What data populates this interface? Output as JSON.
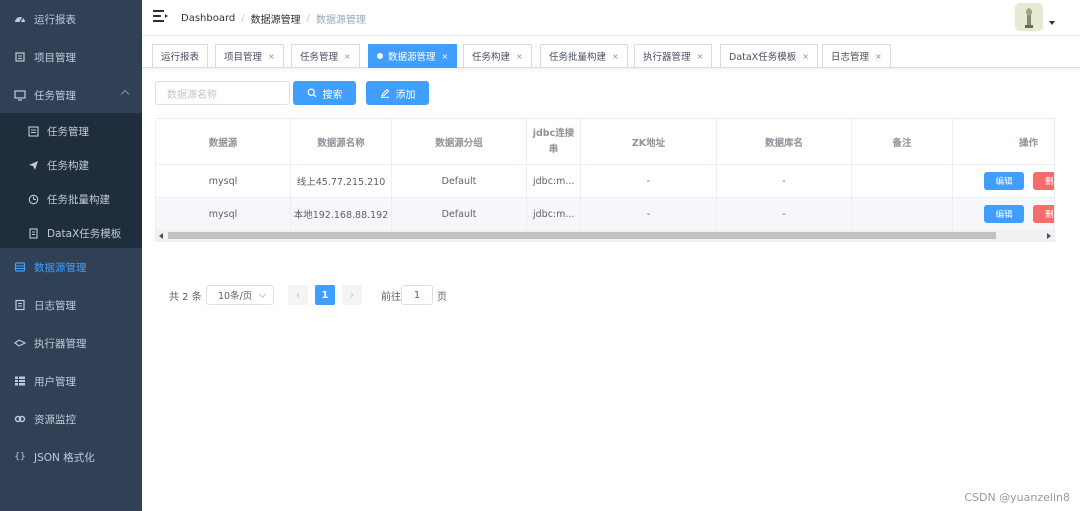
{
  "sidebar": {
    "items": [
      {
        "label": "运行报表",
        "icon": "dashboard-icon"
      },
      {
        "label": "项目管理",
        "icon": "project-icon"
      },
      {
        "label": "任务管理",
        "icon": "monitor-icon"
      },
      {
        "label": "数据源管理",
        "icon": "database-icon"
      },
      {
        "label": "日志管理",
        "icon": "log-icon"
      },
      {
        "label": "执行器管理",
        "icon": "executor-icon"
      },
      {
        "label": "用户管理",
        "icon": "user-table-icon"
      },
      {
        "label": "资源监控",
        "icon": "link-icon"
      },
      {
        "label": "JSON 格式化",
        "icon": "braces-icon"
      }
    ],
    "submenu": [
      {
        "label": "任务管理",
        "icon": "list-icon"
      },
      {
        "label": "任务构建",
        "icon": "send-icon"
      },
      {
        "label": "任务批量构建",
        "icon": "batch-icon"
      },
      {
        "label": "DataX任务模板",
        "icon": "template-icon"
      }
    ],
    "active_color": "#409eff",
    "bg_color": "#304156"
  },
  "navbar": {
    "breadcrumb": [
      "Dashboard",
      "数据源管理",
      "数据源管理"
    ],
    "separator": "/"
  },
  "tags": [
    {
      "label": "运行报表",
      "active": false
    },
    {
      "label": "项目管理",
      "active": false
    },
    {
      "label": "任务管理",
      "active": false
    },
    {
      "label": "数据源管理",
      "active": true
    },
    {
      "label": "任务构建",
      "active": false
    },
    {
      "label": "任务批量构建",
      "active": false
    },
    {
      "label": "执行器管理",
      "active": false
    },
    {
      "label": "DataX任务模板",
      "active": false
    },
    {
      "label": "日志管理",
      "active": false
    }
  ],
  "tag_close": "×",
  "filter": {
    "placeholder": "数据源名称",
    "search_label": "搜索",
    "add_label": "添加"
  },
  "table": {
    "headers": [
      "数据源",
      "数据源名称",
      "数据源分组",
      "jdbc连接串",
      "ZK地址",
      "数据库名",
      "备注",
      "操作"
    ],
    "rows": [
      [
        "mysql",
        "线上45.77.215.210",
        "Default",
        "jdbc:m...",
        "-",
        "-",
        ""
      ],
      [
        "mysql",
        "本地192.168.88.192",
        "Default",
        "jdbc:m...",
        "-",
        "-",
        ""
      ]
    ],
    "edit_label": "编辑",
    "delete_label": "删除"
  },
  "pagination": {
    "total_text": "共 2 条",
    "page_size": "10条/页",
    "prev": "‹",
    "next": "›",
    "current_page": "1",
    "goto_label": "前往",
    "goto_value": "1",
    "page_suffix": "页"
  },
  "watermark": "CSDN @yuanzelin8"
}
